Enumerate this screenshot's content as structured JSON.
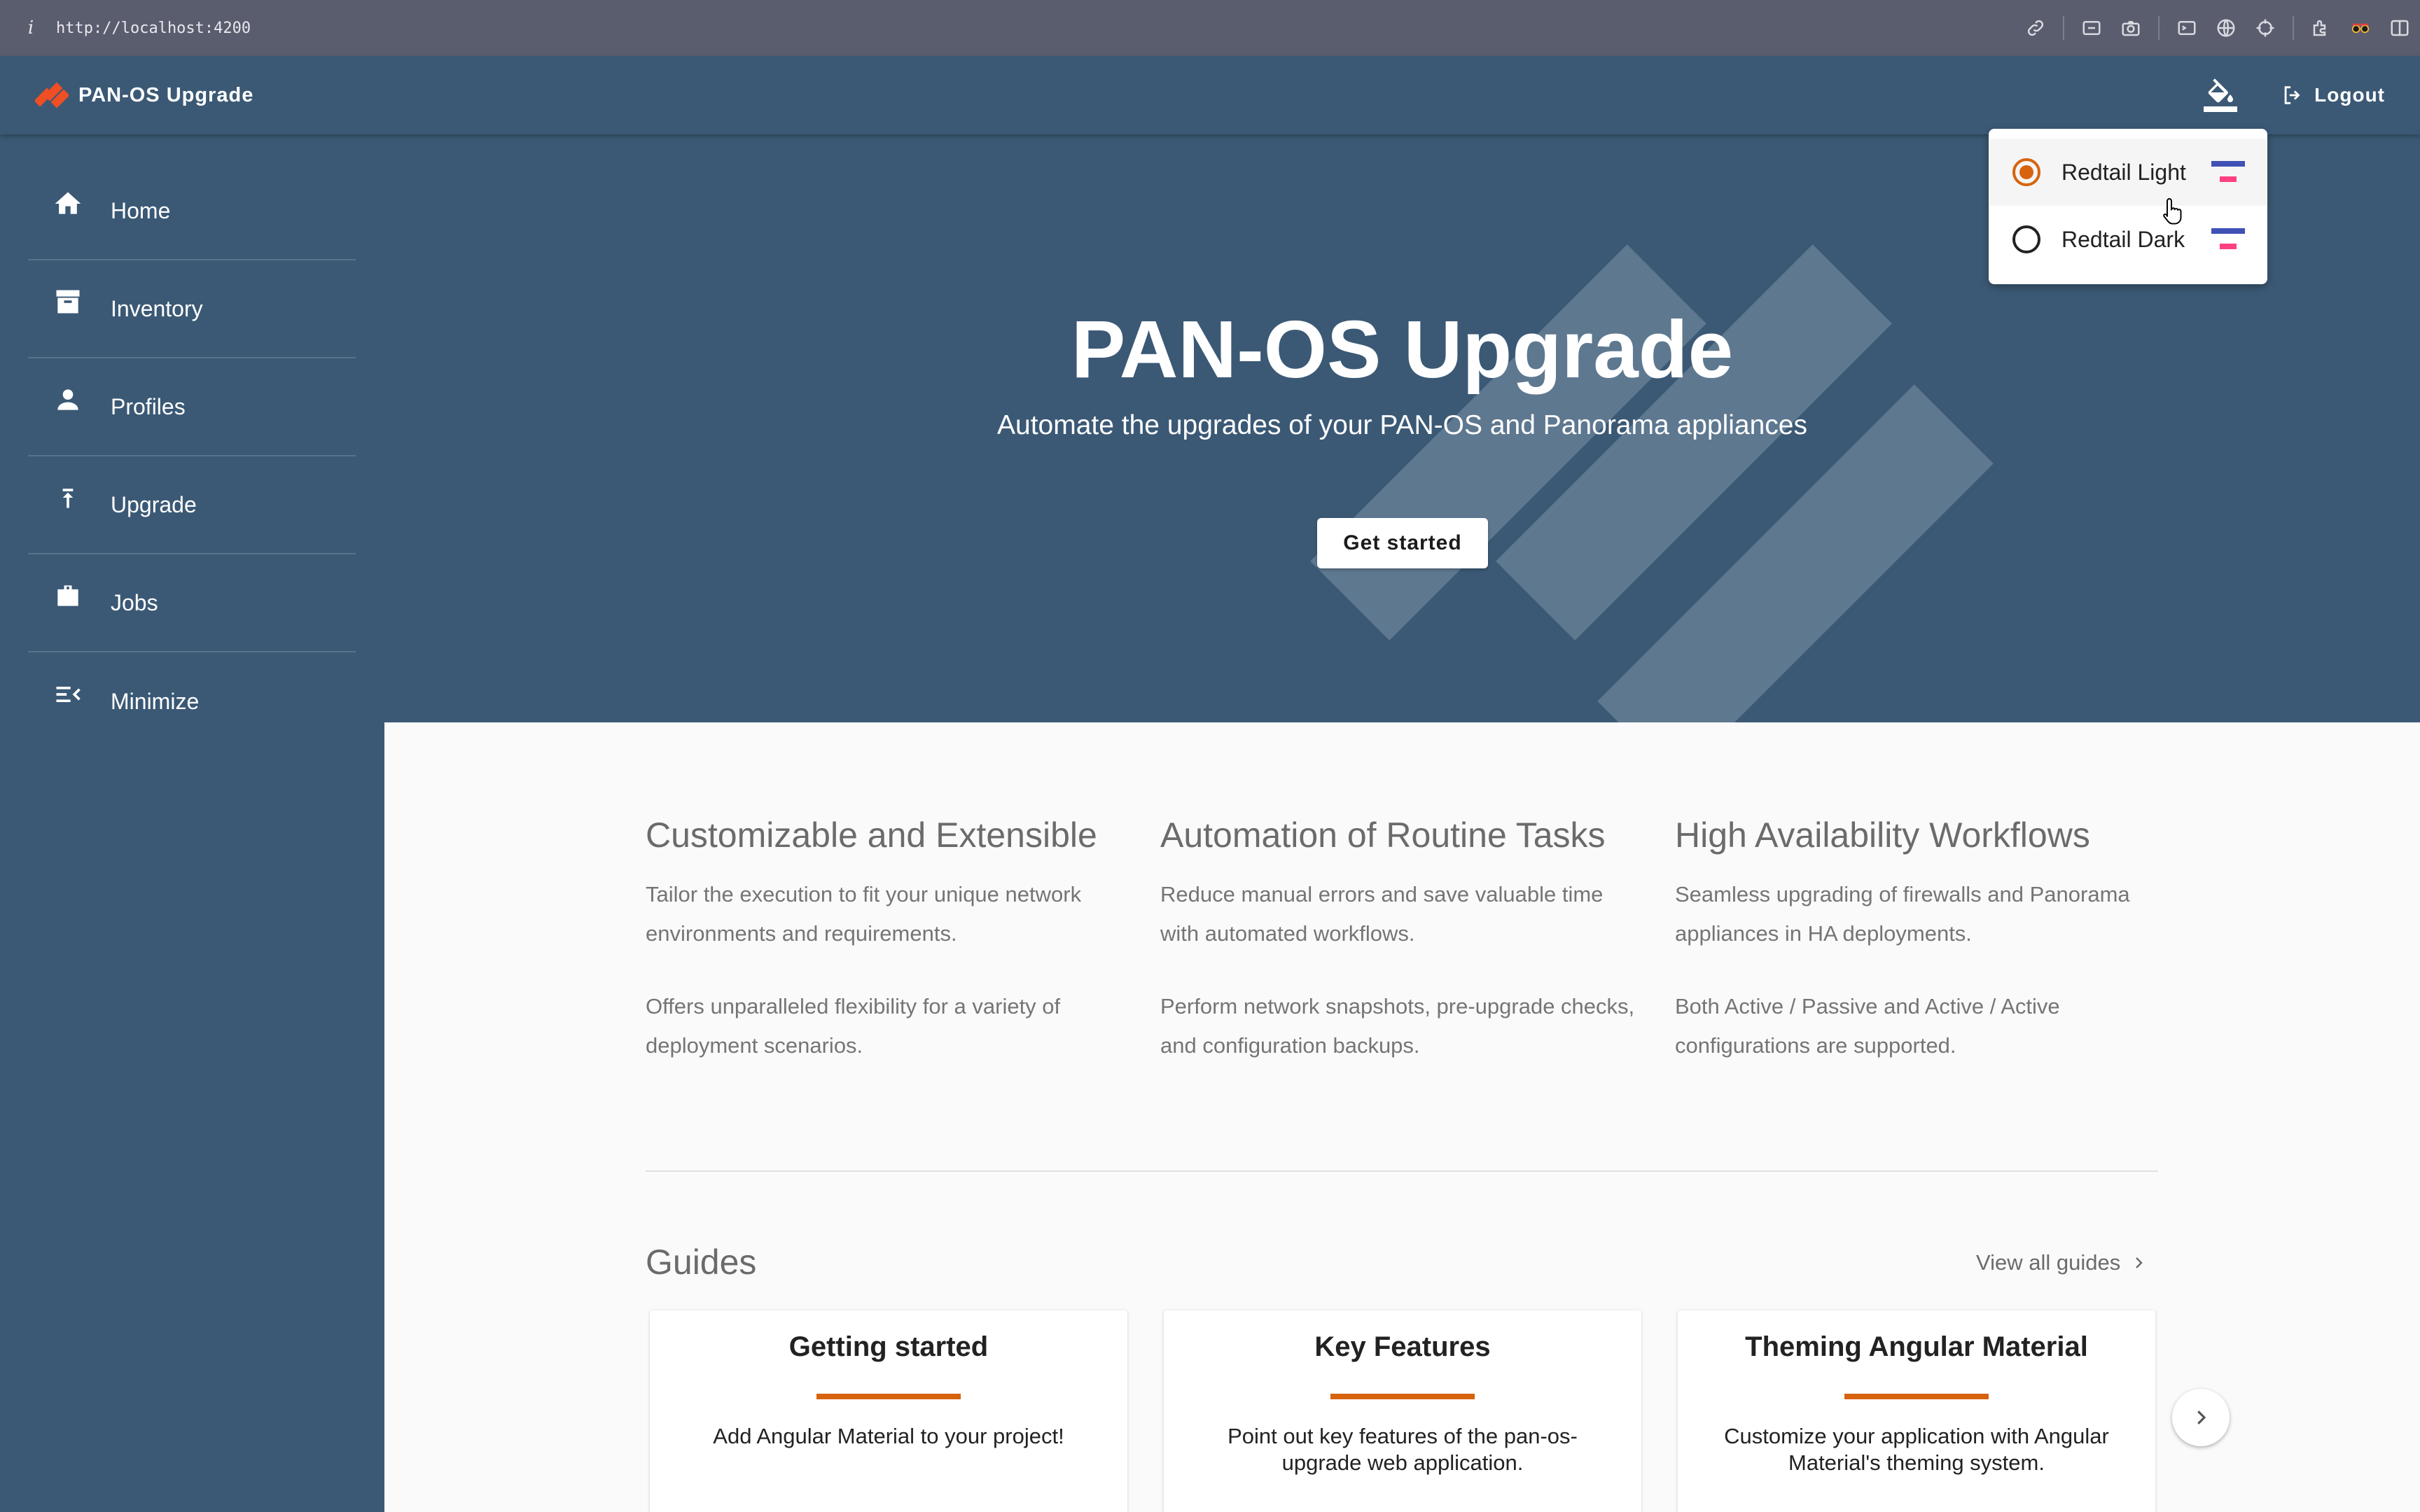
{
  "browser": {
    "info": "i",
    "url": "http://localhost:4200"
  },
  "toolbar": {
    "title": "PAN-OS Upgrade",
    "logout_label": "Logout"
  },
  "sidebar": {
    "items": [
      {
        "label": "Home",
        "icon": "home-icon"
      },
      {
        "label": "Inventory",
        "icon": "archive-icon"
      },
      {
        "label": "Profiles",
        "icon": "person-icon"
      },
      {
        "label": "Upgrade",
        "icon": "upload-arrow-icon"
      },
      {
        "label": "Jobs",
        "icon": "briefcase-icon"
      },
      {
        "label": "Minimize",
        "icon": "menu-collapse-icon"
      }
    ]
  },
  "hero": {
    "title": "PAN-OS Upgrade",
    "subtitle": "Automate the upgrades of your PAN-OS and Panorama appliances",
    "cta": "Get started"
  },
  "features": [
    {
      "title": "Customizable and Extensible",
      "p1": "Tailor the execution to fit your unique network environments and requirements.",
      "p2": "Offers unparalleled flexibility for a variety of deployment scenarios."
    },
    {
      "title": "Automation of Routine Tasks",
      "p1": "Reduce manual errors and save valuable time with automated workflows.",
      "p2": "Perform network snapshots, pre-upgrade checks, and configuration backups."
    },
    {
      "title": "High Availability Workflows",
      "p1": "Seamless upgrading of firewalls and Panorama appliances in HA deployments.",
      "p2": "Both Active / Passive and Active / Active configurations are supported."
    }
  ],
  "guides": {
    "title": "Guides",
    "view_all": "View all guides",
    "cards": [
      {
        "title": "Getting started",
        "description": "Add Angular Material to your project!"
      },
      {
        "title": "Key Features",
        "description": "Point out key features of the pan-os-upgrade web application."
      },
      {
        "title": "Theming Angular Material",
        "description": "Customize your application with Angular Material's theming system."
      }
    ]
  },
  "theme_menu": {
    "options": [
      {
        "label": "Redtail Light",
        "selected": true
      },
      {
        "label": "Redtail Dark",
        "selected": false
      }
    ]
  },
  "colors": {
    "primary": "#3b5975",
    "accent": "#d7630f",
    "swatch_primary": "#3f51b5",
    "swatch_accent": "#ff4081"
  }
}
